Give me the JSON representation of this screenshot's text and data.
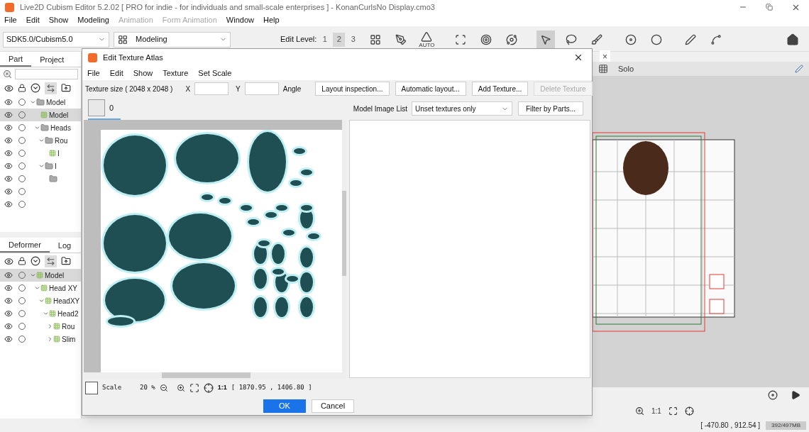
{
  "window": {
    "title": "Live2D Cubism Editor 5.2.02    [ PRO for indie - for individuals and small-scale enterprises ]  - KonanCurlsNo Display.cmo3"
  },
  "menu": [
    {
      "label": "File",
      "disabled": false
    },
    {
      "label": "Edit",
      "disabled": false
    },
    {
      "label": "Show",
      "disabled": false
    },
    {
      "label": "Modeling",
      "disabled": false
    },
    {
      "label": "Animation",
      "disabled": true
    },
    {
      "label": "Form Animation",
      "disabled": true
    },
    {
      "label": "Window",
      "disabled": false
    },
    {
      "label": "Help",
      "disabled": false
    }
  ],
  "toolbar": {
    "sdk_select": "SDK5.0/Cubism5.0",
    "mode_select": "Modeling",
    "edit_level_label": "Edit Level:",
    "edit_levels": [
      {
        "label": "1",
        "selected": false
      },
      {
        "label": "2",
        "selected": true
      },
      {
        "label": "3",
        "selected": false
      }
    ],
    "tools": [
      {
        "kind": "layout",
        "selected": false
      },
      {
        "kind": "mesh",
        "selected": false
      },
      {
        "kind": "auto",
        "label": "AUTO",
        "selected": false
      },
      {
        "kind": "warp",
        "selected": false
      },
      {
        "kind": "rotate",
        "selected": false
      },
      {
        "kind": "rotate2",
        "selected": false
      },
      {
        "kind": "select",
        "selected": true
      },
      {
        "kind": "lasso",
        "selected": false
      },
      {
        "kind": "brush",
        "selected": false
      },
      {
        "kind": "glue",
        "selected": false
      },
      {
        "kind": "glue-brush",
        "selected": false
      },
      {
        "kind": "pen",
        "selected": false
      },
      {
        "kind": "path",
        "selected": false
      }
    ]
  },
  "part_panel": {
    "tabs": [
      {
        "label": "Part",
        "selected": true
      },
      {
        "label": "Project",
        "selected": false
      }
    ],
    "tree": [
      {
        "label": "Model",
        "kind": "folder",
        "selected": false,
        "children": [
          {
            "label": "Model",
            "kind": "mesh",
            "selected": true
          },
          {
            "label": "Heads",
            "kind": "folder",
            "selected": false,
            "children": [
              {
                "label": "Rou",
                "kind": "folder",
                "selected": false,
                "children": [
                  {
                    "label": "I",
                    "kind": "mesh",
                    "selected": false
                  }
                ]
              },
              {
                "label": "I",
                "kind": "folder",
                "selected": false,
                "children": [
                  {
                    "kind": "folder",
                    "selected": false
                  },
                  {
                    "kind": "blank",
                    "selected": false
                  },
                  {
                    "kind": "blank",
                    "selected": false
                  }
                ]
              }
            ]
          }
        ]
      }
    ]
  },
  "deformer_panel": {
    "tabs": [
      {
        "label": "Deformer",
        "selected": true
      },
      {
        "label": "Log",
        "selected": false
      }
    ],
    "tree": [
      {
        "label": "Model",
        "kind": "deformer",
        "selected": true,
        "children": [
          {
            "label": "Head XY",
            "kind": "deformer",
            "selected": false,
            "children": [
              {
                "label": "HeadXY",
                "kind": "deformer",
                "selected": false,
                "children": [
                  {
                    "label": "Head2",
                    "kind": "deformer",
                    "selected": false,
                    "children": [
                      {
                        "label": "Rou",
                        "kind": "deformer",
                        "collapsed": true,
                        "selected": false
                      },
                      {
                        "label": "Slim",
                        "kind": "deformer",
                        "collapsed": true,
                        "selected": false
                      }
                    ]
                  }
                ]
              }
            ]
          }
        ]
      }
    ]
  },
  "view_panel": {
    "close": "×",
    "solo": "Solo",
    "zoom_label": "1:1",
    "coords": "[ -470.80 , 912.54 ]",
    "memory": "392/497MB"
  },
  "dialog": {
    "title": "Edit Texture Atlas",
    "menu": [
      "File",
      "Edit",
      "Show",
      "Texture",
      "Set Scale"
    ],
    "texture_size": "Texture size ( 2048 x 2048 )",
    "x_label": "X",
    "y_label": "Y",
    "angle_label": "Angle",
    "buttons": [
      {
        "label": "Layout inspection...",
        "disabled": false
      },
      {
        "label": "Automatic layout...",
        "disabled": false
      },
      {
        "label": "Add Texture...",
        "disabled": false
      },
      {
        "label": "Delete Texture",
        "disabled": true
      }
    ],
    "texture_tabs": [
      {
        "label": "0",
        "selected": true
      }
    ],
    "model_image_list_label": "Model Image List",
    "model_image_list": "Unset textures only",
    "filter_button": "Filter by Parts...",
    "scale_label": "Scale",
    "scale": "20 %",
    "ratio": "1:1",
    "coords": "[ 1870.95 , 1406.80 ]",
    "ok": "OK",
    "cancel": "Cancel"
  }
}
